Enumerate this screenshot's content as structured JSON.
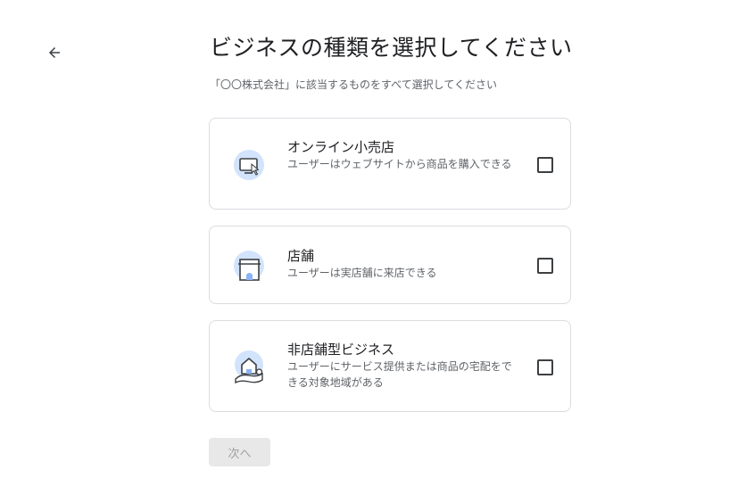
{
  "header": {
    "title": "ビジネスの種類を選択してください",
    "subtitle": "「〇〇株式会社」に該当するものをすべて選択してください"
  },
  "options": [
    {
      "title": "オンライン小売店",
      "description": "ユーザーはウェブサイトから商品を購入できる",
      "icon": "online-store-icon",
      "checked": false
    },
    {
      "title": "店舗",
      "description": "ユーザーは実店舗に来店できる",
      "icon": "storefront-icon",
      "checked": false
    },
    {
      "title": "非店舗型ビジネス",
      "description": "ユーザーにサービス提供または商品の宅配をできる対象地域がある",
      "icon": "service-area-icon",
      "checked": false
    }
  ],
  "footer": {
    "next_label": "次へ"
  },
  "colors": {
    "icon_bg": "#d2e3fc",
    "icon_accent": "#4285f4",
    "border": "#dadce0",
    "disabled_bg": "#e8e8e8",
    "disabled_text": "#a0a0a0"
  }
}
